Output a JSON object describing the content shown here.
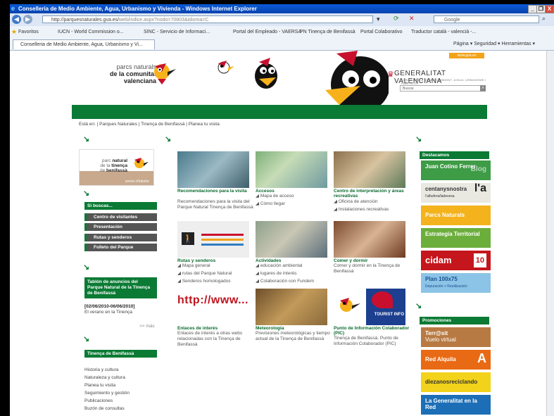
{
  "window": {
    "title": "Conselleria de Medio Ambiente, Agua, Urbanismo y Vivienda - Windows Internet Explorer",
    "minimize": "_",
    "restore": "❐",
    "close": "X"
  },
  "address": {
    "url_prefix": "http://parquesnaturales.gva.es/",
    "url_suffix": "web/indice.aspx?nodo=70803&idioma=C",
    "search_placeholder": "Google"
  },
  "favorites": {
    "label": "Favoritos",
    "items": [
      "IUCN - World Commission o...",
      "SINC - Servicio de Informaci...",
      "Portal del Empleado - VAERSA",
      "PN Tinença de Benifassà",
      "Portal Colaborativo",
      "Traductor català - valencià -..."
    ]
  },
  "tab": {
    "label": "Conselleria de Medio Ambiente, Agua, Urbanismo y Vi...",
    "tools": "Página ▾   Seguridad ▾   Herramientas ▾"
  },
  "header": {
    "brand_line1": "parcs naturals",
    "brand_line2": "de la comunitat",
    "brand_line3": "valenciana",
    "gva_title": "GENERALITAT VALENCIANA",
    "gva_subtitle": "CONSELLERIA DE MEDI AMBIENT, AIGUA, URBANISME I HABITATGE",
    "gva_url": "www.gva.es",
    "search_label": "Buscar"
  },
  "breadcrumb": {
    "prefix": "Está en:",
    "path": "| Parques Naturales | Tinença de Benifassà | Planea tu visita"
  },
  "left": {
    "logo_text1": "parc",
    "logo_text2": "natural",
    "logo_text3": "de la",
    "logo_text4": "tinença",
    "logo_text5": "de",
    "logo_text6": "benifassà",
    "logo_tag": "serres d'interior",
    "search_head": "Si buscas...",
    "menu": [
      "Centro de visitantes",
      "Presentación",
      "Rutas y senderos",
      "Folleto del Parque"
    ],
    "board_title": "Tablón de anuncios del Parque Natural de la Tinença de Benifassà",
    "board_date": "[02/06/2010-06/06/2010]",
    "board_text": "El verano en la Tinença",
    "more": ">> más",
    "section_head": "Tinença de Benifassà",
    "links": [
      "Historia y cultura",
      "Naturaleza y cultura",
      "Planea tu visita",
      "Seguimiento y gestión",
      "Publicaciones",
      "Buzón de consultas"
    ]
  },
  "tiles": [
    {
      "title": "Recomendaciones para la visita",
      "desc": "Recomendaciones para la visita del Parque Natural Tinença de Benifassà",
      "bullets": []
    },
    {
      "title": "Accesos",
      "desc": "",
      "bullets": [
        "Mapa de acceso",
        "Cómo llegar"
      ]
    },
    {
      "title": "Centro de interpretación y áreas recreativas",
      "desc": "",
      "bullets": [
        "Oficina de atención",
        "Instalaciones recreativas"
      ]
    },
    {
      "title": "Rutas y senderos",
      "desc": "",
      "bullets": [
        "Mapa general",
        "rutas del Parque Natural",
        "Senderos homologados"
      ]
    },
    {
      "title": "Actividades",
      "desc": "",
      "bullets": [
        "educación ambiental",
        "lugares de interés",
        "Colaboración con Fundem"
      ]
    },
    {
      "title": "Comer y dormir",
      "desc": "Comer y dormir en la Tinença de Benifassà",
      "bullets": []
    },
    {
      "title": "Enlaces de interés",
      "desc": "Enlaces de interés a otras webs relacionadas con la Tinença de Benifassà",
      "bullets": []
    },
    {
      "title": "Meteorología",
      "desc": "Previsiones meteorológicas y tiempo actual de la Tinença de Benifassà",
      "bullets": []
    },
    {
      "title": "Punto de Información Colaborador (PIC)",
      "desc": "Tinença de Benifassà. Punto de Información Colaborador (PIC)",
      "bullets": []
    }
  ],
  "http_text": "http://www...",
  "tourist_text": "TOURIST INFO",
  "right": {
    "featured_head": "Destacamos",
    "featured": [
      {
        "label": "Juan Cotino Ferrer",
        "tag": "Blog",
        "color": "#3e9b46"
      },
      {
        "label": "centanysnostra",
        "sub": "l'albufera/ladevesa",
        "tag": "l'a",
        "color": "#e9e9e2"
      },
      {
        "label": "Parcs Naturals",
        "tag": "",
        "color": "#f4b21c"
      },
      {
        "label": "Estrategia Territorial",
        "tag": "",
        "color": "#6cae3c"
      },
      {
        "label": "cidam",
        "tag": "10",
        "color": "#c4161c"
      },
      {
        "label": "Plan 100x75",
        "sub": "Depuración + Reutilización",
        "tag": "",
        "color": "#8bc4e6"
      }
    ],
    "promo_head": "Promociones",
    "promos": [
      {
        "label": "Terr@sit",
        "sub": "Vuelo virtual",
        "color": "#b87a43"
      },
      {
        "label": "Red Alquila",
        "tag": "A",
        "color": "#e96a14"
      },
      {
        "label": "diezanosreciclando",
        "color": "#f2d21a"
      },
      {
        "label": "La Generalitat en la Red",
        "color": "#1c6fb6"
      }
    ]
  }
}
